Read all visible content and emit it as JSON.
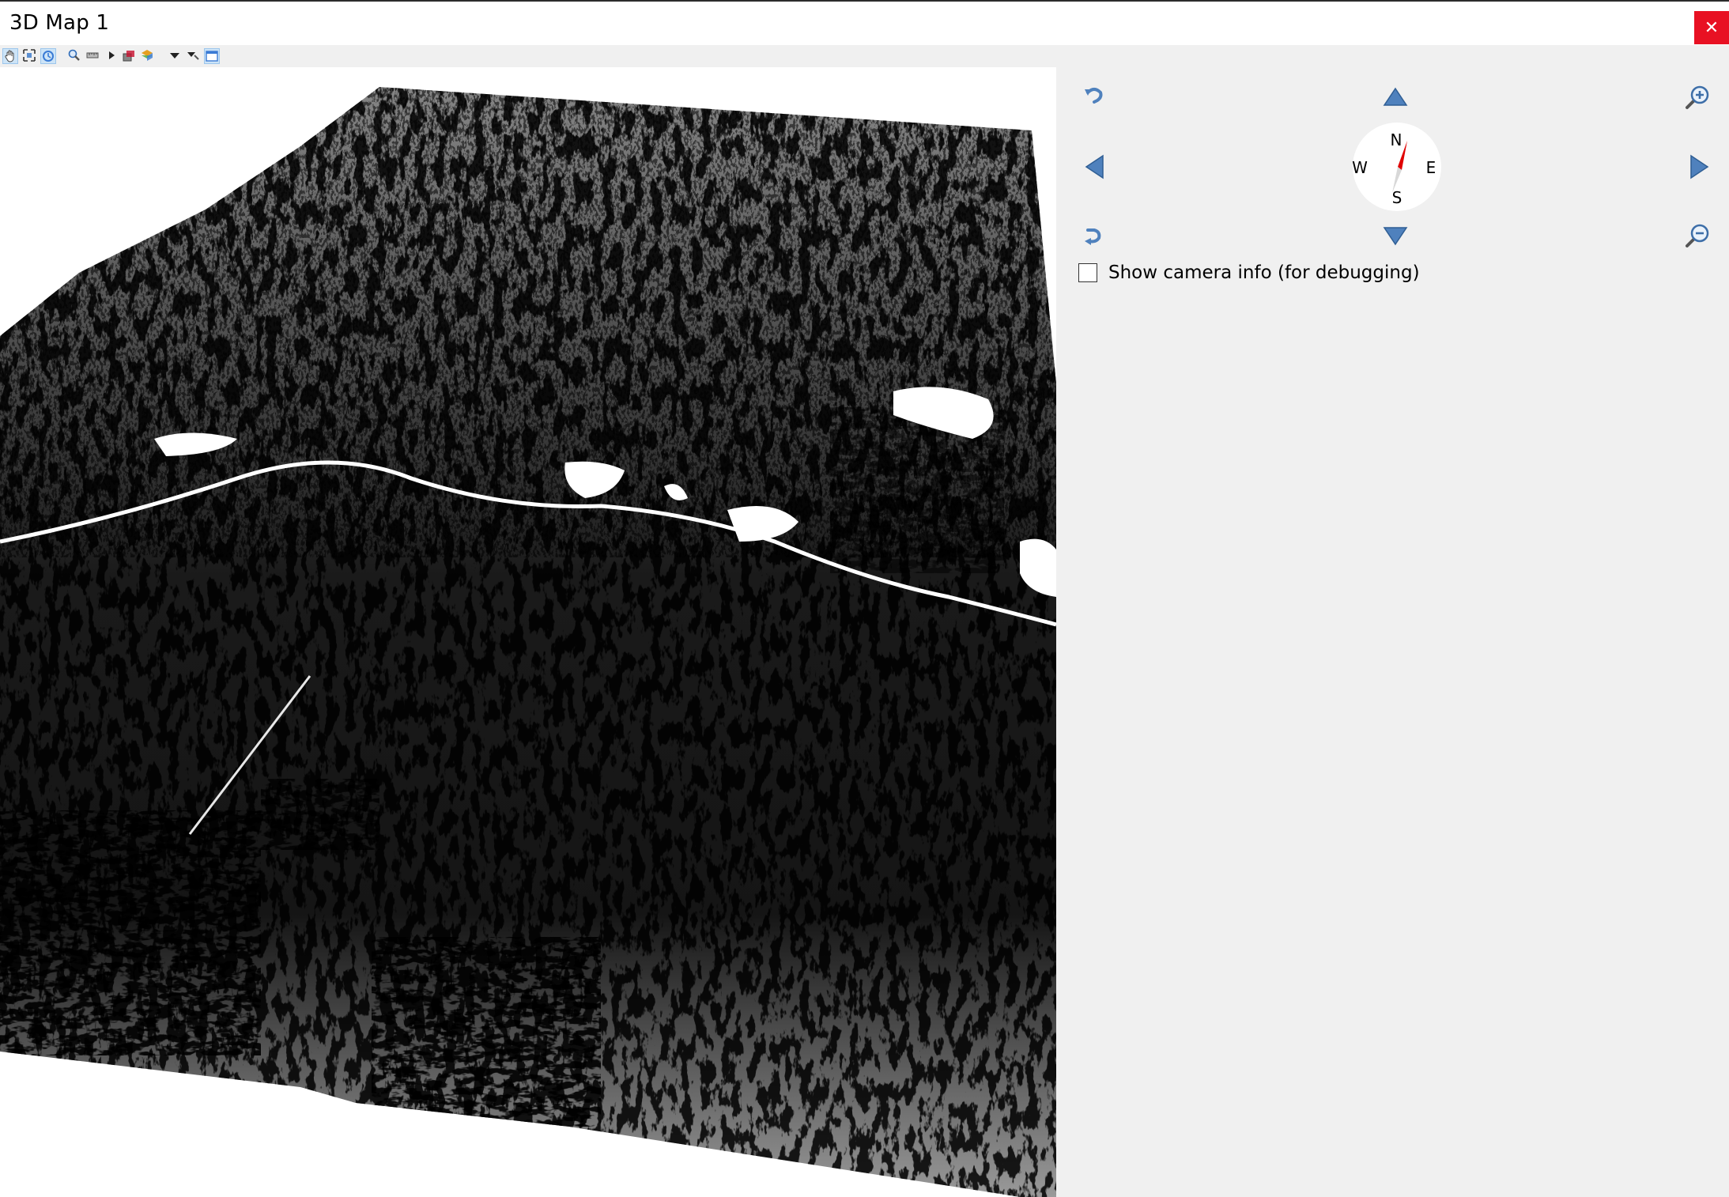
{
  "window": {
    "title": "3D Map 1",
    "close_glyph": "✕"
  },
  "toolbar": {
    "icons": [
      "pan-icon",
      "zoom-full-icon",
      "camera-rotate-icon",
      "identify-icon",
      "measure-icon",
      "animation-play-icon",
      "export-image-icon",
      "map-themes-icon",
      "camera-dropdown-icon",
      "options-dropdown-icon",
      "dock-icon"
    ]
  },
  "navigation": {
    "compass": {
      "north": "N",
      "south": "S",
      "east": "E",
      "west": "W"
    },
    "icons": {
      "rotate_up": "rotate-ccw-icon",
      "rotate_down": "rotate-cw-icon",
      "move_up": "arrow-up-icon",
      "move_down": "arrow-down-icon",
      "move_left": "arrow-left-icon",
      "move_right": "arrow-right-icon",
      "zoom_in": "zoom-in-icon",
      "zoom_out": "zoom-out-icon"
    }
  },
  "camera_info": {
    "label": "Show camera info (for debugging)",
    "checked": false
  },
  "colors": {
    "close": "#e81123",
    "nav_arrow": "#4f81bd",
    "compass_needle": "#e00000",
    "panel_bg": "#f0f0f0"
  }
}
